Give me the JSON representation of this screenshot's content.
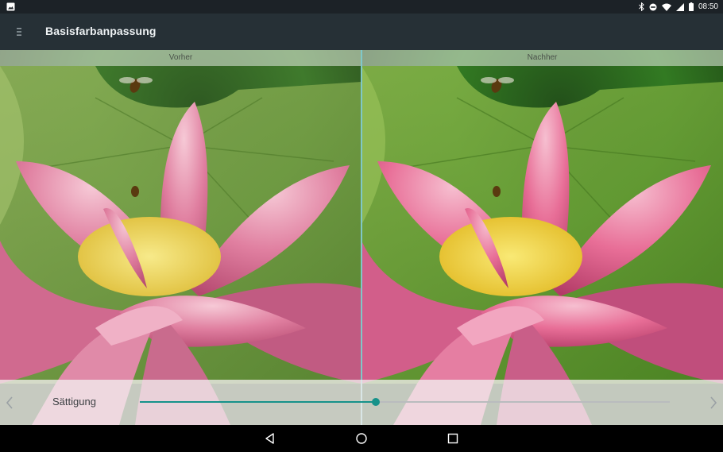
{
  "status_bar": {
    "time": "08:50",
    "icons": [
      "image-icon",
      "bluetooth-icon",
      "do-not-disturb-icon",
      "wifi-icon",
      "signal-icon",
      "battery-icon"
    ]
  },
  "toolbar": {
    "menu_icon": "menu-icon",
    "title": "Basisfarbanpassung"
  },
  "compare": {
    "before_label": "Vorher",
    "after_label": "Nachher"
  },
  "adjustment": {
    "label": "Sättigung",
    "value_fraction": 0.445,
    "accent_color": "#16928a",
    "prev_icon": "chevron-left-icon",
    "next_icon": "chevron-right-icon"
  },
  "nav_bar": {
    "icons": [
      "back-icon",
      "home-icon",
      "recents-icon"
    ]
  }
}
